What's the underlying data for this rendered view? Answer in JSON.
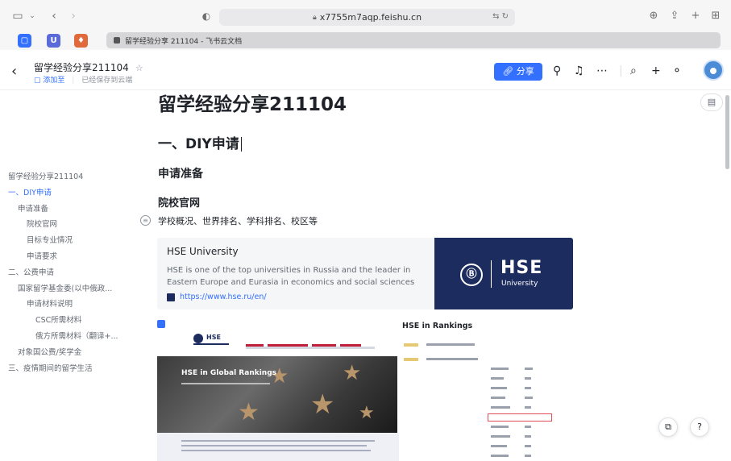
{
  "browser": {
    "url": "x7755m7aqp.feishu.cn",
    "tab_title": "留学经验分享 211104 - 飞书云文档"
  },
  "header": {
    "title": "留学经验分享211104",
    "add_to": "添加至",
    "saved_status": "已经保存到云端",
    "share_label": "分享"
  },
  "outline": [
    {
      "label": "留学经验分享211104",
      "level": 0,
      "active": false
    },
    {
      "label": "一、DIY申请",
      "level": 0,
      "active": true
    },
    {
      "label": "申请准备",
      "level": 1,
      "active": false
    },
    {
      "label": "院校官网",
      "level": 2,
      "active": false
    },
    {
      "label": "目标专业情况",
      "level": 2,
      "active": false
    },
    {
      "label": "申请要求",
      "level": 2,
      "active": false
    },
    {
      "label": "二、公费申请",
      "level": 0,
      "active": false
    },
    {
      "label": "国家留学基金委(以中俄政...",
      "level": 1,
      "active": false
    },
    {
      "label": "申请材料说明",
      "level": 2,
      "active": false
    },
    {
      "label": "CSC所需材料",
      "level": 3,
      "active": false
    },
    {
      "label": "俄方所需材料（翻译+...",
      "level": 3,
      "active": false
    },
    {
      "label": "对象国公费/奖学金",
      "level": 1,
      "active": false
    },
    {
      "label": "三、疫情期间的留学生活",
      "level": 0,
      "active": false
    }
  ],
  "document": {
    "title": "留学经验分享211104",
    "h1": "一、DIY申请",
    "h2": "申请准备",
    "h3": "院校官网",
    "paragraph": "学校概况、世界排名、学科排名、校区等"
  },
  "link_card": {
    "title": "HSE University",
    "description": "HSE is one of the top universities in Russia and the leader in Eastern Europe and Eurasia in economics and social sciences",
    "url": "https://www.hse.ru/en/",
    "banner_name": "HSE",
    "banner_sub": "University"
  },
  "screenshot": {
    "logo_text": "HSE",
    "hero_title": "HSE in Global Rankings",
    "rankings_title": "HSE in Rankings"
  },
  "colors": {
    "accent": "#3370ff",
    "hse_navy": "#1d2c5e"
  }
}
